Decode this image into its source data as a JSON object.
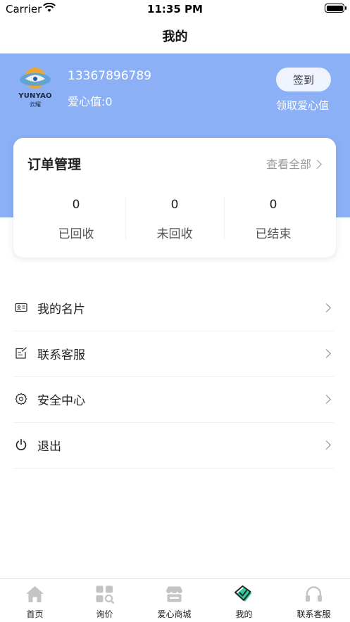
{
  "status_bar": {
    "carrier": "Carrier",
    "time": "11:35 PM"
  },
  "nav": {
    "title": "我的"
  },
  "profile": {
    "logo_text": "YUNYAO",
    "logo_sub": "云耀",
    "phone": "13367896789",
    "love_value": "爱心值:0",
    "signin_label": "签到",
    "claim_label": "领取爱心值"
  },
  "orders": {
    "title": "订单管理",
    "view_all": "查看全部",
    "stats": [
      {
        "value": "0",
        "label": "已回收"
      },
      {
        "value": "0",
        "label": "未回收"
      },
      {
        "value": "0",
        "label": "已结束"
      }
    ]
  },
  "menu": [
    {
      "label": "我的名片",
      "icon": "id-card-icon"
    },
    {
      "label": "联系客服",
      "icon": "edit-note-icon"
    },
    {
      "label": "安全中心",
      "icon": "gear-icon"
    },
    {
      "label": "退出",
      "icon": "power-icon"
    }
  ],
  "tabs": [
    {
      "label": "首页",
      "icon": "home-icon",
      "active": false
    },
    {
      "label": "询价",
      "icon": "inquiry-grid-icon",
      "active": false
    },
    {
      "label": "爱心商城",
      "icon": "store-icon",
      "active": false
    },
    {
      "label": "我的",
      "icon": "profile-shield-icon",
      "active": true
    },
    {
      "label": "联系客服",
      "icon": "headset-icon",
      "active": false
    }
  ],
  "colors": {
    "header": "#8cb0f6",
    "active_tab": "#35c9a0",
    "inactive_tab": "#c4c4c4"
  }
}
